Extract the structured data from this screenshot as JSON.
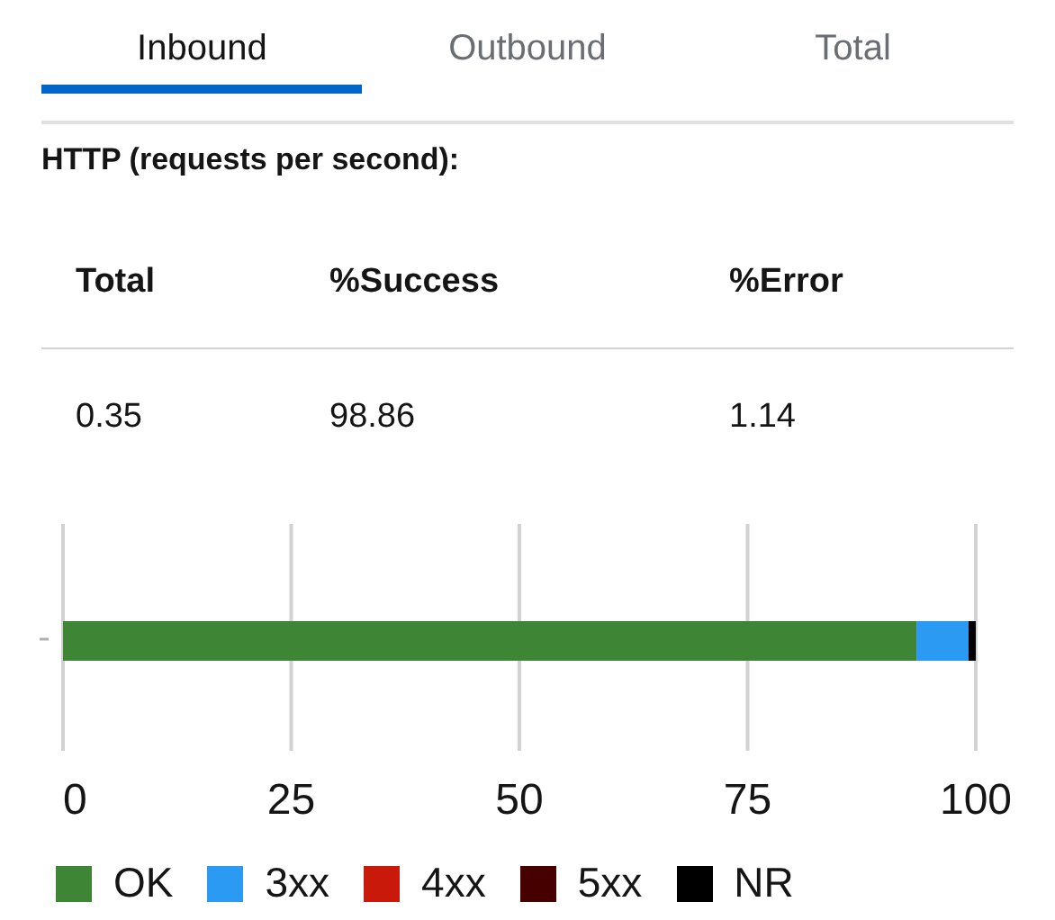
{
  "tabs": [
    {
      "label": "Inbound",
      "selected": true
    },
    {
      "label": "Outbound",
      "selected": false
    },
    {
      "label": "Total",
      "selected": false
    }
  ],
  "http": {
    "heading": "HTTP (requests per second):",
    "columns": [
      "Total",
      "%Success",
      "%Error"
    ],
    "rows": [
      [
        "0.35",
        "98.86",
        "1.14"
      ]
    ],
    "chart_data": {
      "type": "bar",
      "orientation": "horizontal",
      "stacked": true,
      "grid": true,
      "xlim": [
        0,
        100
      ],
      "xticks": [
        0,
        25,
        50,
        75,
        100
      ],
      "series": [
        {
          "name": "OK",
          "color": "#3e8635",
          "values": [
            93.5
          ]
        },
        {
          "name": "3xx",
          "color": "#2b9af3",
          "values": [
            5.7
          ]
        },
        {
          "name": "4xx",
          "color": "#c9190b",
          "values": [
            0
          ]
        },
        {
          "name": "5xx",
          "color": "#470000",
          "values": [
            0
          ]
        },
        {
          "name": "NR",
          "color": "#000000",
          "values": [
            0.8
          ]
        }
      ]
    }
  }
}
